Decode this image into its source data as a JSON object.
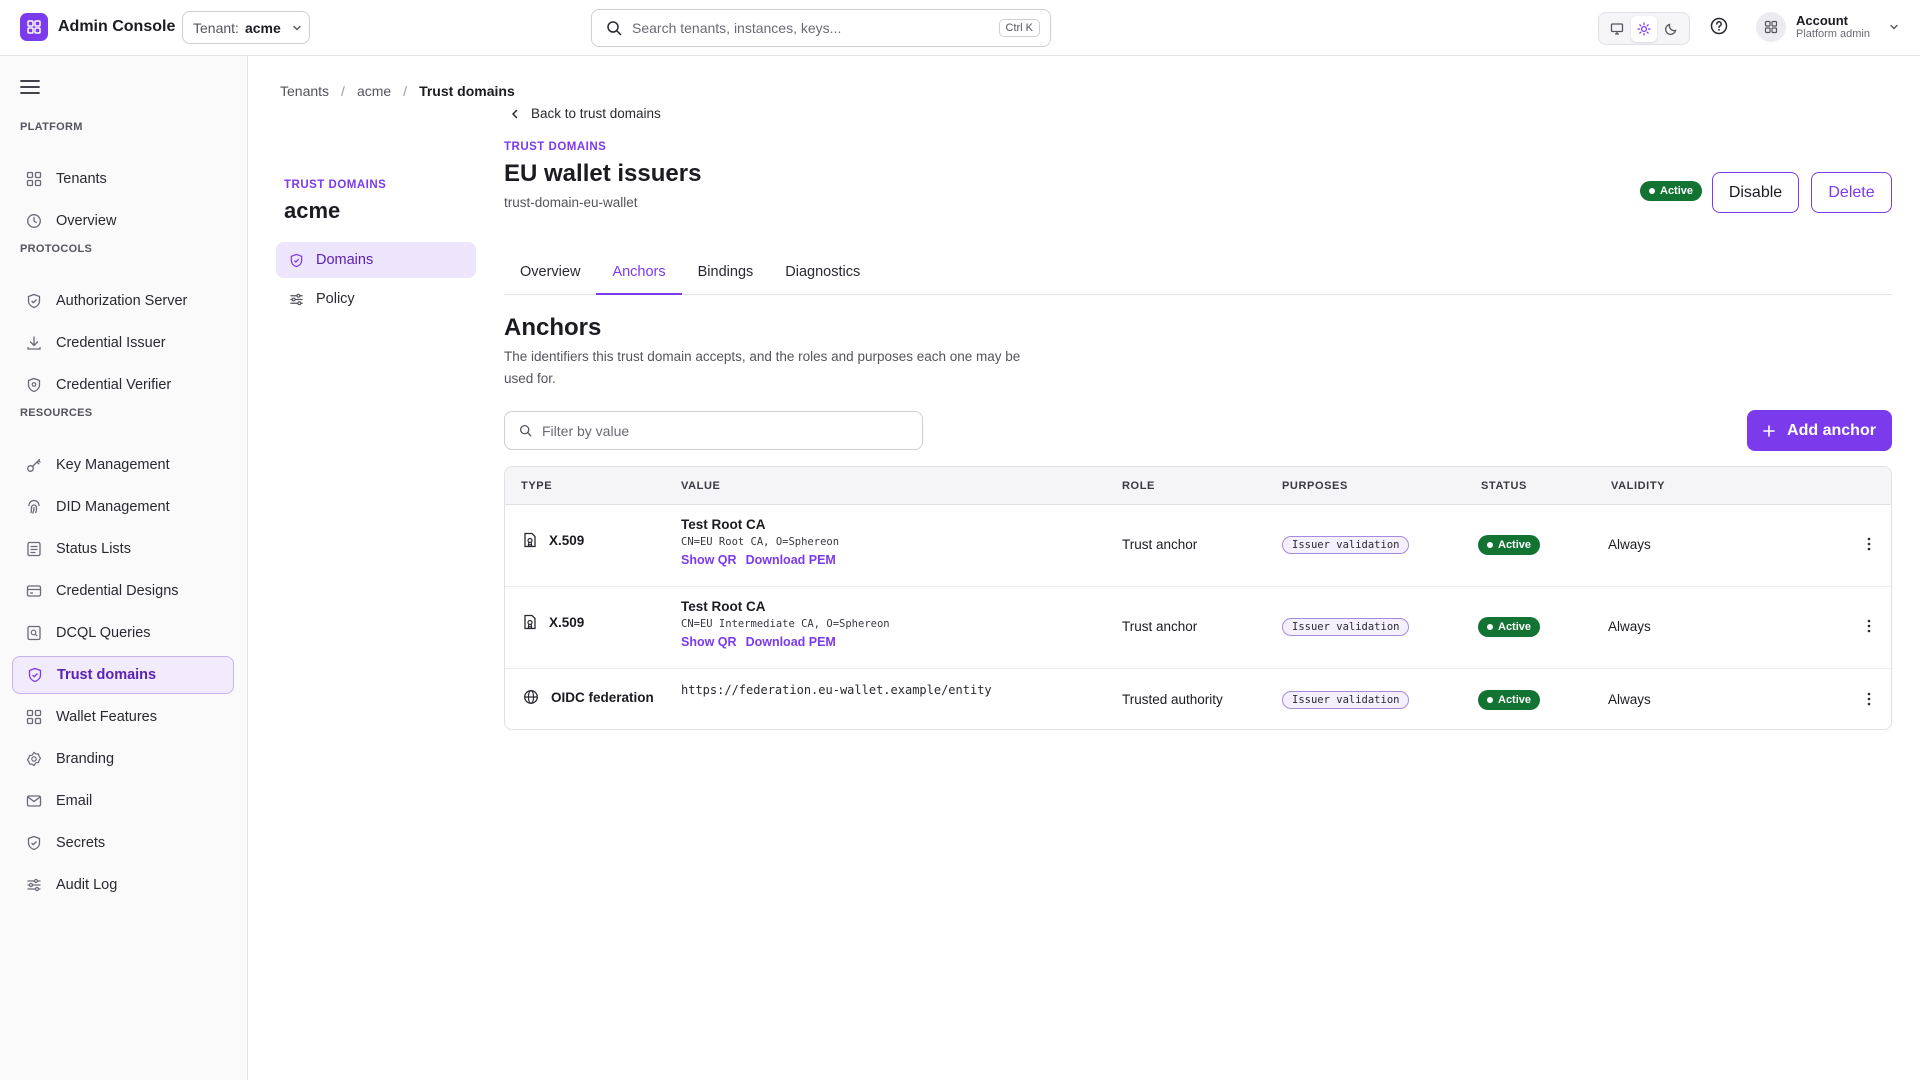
{
  "app": {
    "title": "Admin Console",
    "tenant_label": "Tenant:",
    "tenant_value": "acme",
    "search_placeholder": "Search tenants, instances, keys...",
    "search_shortcut": "Ctrl K",
    "account_name": "Account",
    "account_role": "Platform admin",
    "accent_color": "#7c3aed",
    "success_color": "#137333"
  },
  "sidebar": {
    "sections": [
      {
        "label": "PLATFORM",
        "items": [
          {
            "label": "Tenants",
            "icon": "grid-icon"
          },
          {
            "label": "Overview",
            "icon": "clock-icon"
          }
        ]
      },
      {
        "label": "PROTOCOLS",
        "items": [
          {
            "label": "Authorization Server",
            "icon": "shield-check-icon"
          },
          {
            "label": "Credential Issuer",
            "icon": "download-icon"
          },
          {
            "label": "Credential Verifier",
            "icon": "shield-icon"
          }
        ]
      },
      {
        "label": "RESOURCES",
        "items": [
          {
            "label": "Key Management",
            "icon": "key-icon"
          },
          {
            "label": "DID Management",
            "icon": "fingerprint-icon"
          },
          {
            "label": "Status Lists",
            "icon": "list-icon"
          },
          {
            "label": "Credential Designs",
            "icon": "card-icon"
          },
          {
            "label": "DCQL Queries",
            "icon": "query-icon"
          },
          {
            "label": "Trust domains",
            "icon": "shield-check-icon",
            "active": true
          },
          {
            "label": "Wallet Features",
            "icon": "grid-icon"
          },
          {
            "label": "Branding",
            "icon": "badge-icon"
          },
          {
            "label": "Email",
            "icon": "mail-icon"
          },
          {
            "label": "Secrets",
            "icon": "shield-check-icon"
          },
          {
            "label": "Audit Log",
            "icon": "sliders-icon"
          }
        ]
      }
    ]
  },
  "breadcrumb": [
    "Tenants",
    "acme",
    "Trust domains"
  ],
  "subpanel": {
    "label": "TRUST DOMAINS",
    "title": "acme",
    "items": [
      {
        "label": "Domains",
        "icon": "shield-check-icon",
        "active": true
      },
      {
        "label": "Policy",
        "icon": "sliders-icon"
      }
    ]
  },
  "domain": {
    "back_label": "Back to trust domains",
    "overline": "TRUST DOMAINS",
    "title": "EU wallet issuers",
    "identifier": "trust-domain-eu-wallet",
    "status": "Active",
    "disable_label": "Disable",
    "delete_label": "Delete"
  },
  "tabs": [
    {
      "label": "Overview"
    },
    {
      "label": "Anchors",
      "active": true
    },
    {
      "label": "Bindings"
    },
    {
      "label": "Diagnostics"
    }
  ],
  "anchors": {
    "title": "Anchors",
    "description": "The identifiers this trust domain accepts, and the roles and purposes each one may be used for.",
    "filter_placeholder": "Filter by value",
    "add_label": "Add anchor",
    "columns": [
      "TYPE",
      "VALUE",
      "ROLE",
      "PURPOSES",
      "STATUS",
      "VALIDITY"
    ],
    "rows": [
      {
        "type": "X.509",
        "type_icon": "certificate-icon",
        "value_title": "Test Root CA",
        "value_sub": "CN=EU Root CA, O=Sphereon",
        "links": [
          "Show QR",
          "Download PEM"
        ],
        "role": "Trust anchor",
        "purpose": "Issuer validation",
        "status": "Active",
        "validity": "Always"
      },
      {
        "type": "X.509",
        "type_icon": "certificate-icon",
        "value_title": "Test Root CA",
        "value_sub": "CN=EU Intermediate CA, O=Sphereon",
        "links": [
          "Show QR",
          "Download PEM"
        ],
        "role": "Trust anchor",
        "purpose": "Issuer validation",
        "status": "Active",
        "validity": "Always"
      },
      {
        "type": "OIDC federation",
        "type_icon": "globe-icon",
        "value_url": "https://federation.eu-wallet.example/entity",
        "role": "Trusted authority",
        "purpose": "Issuer validation",
        "status": "Active",
        "validity": "Always"
      }
    ]
  }
}
